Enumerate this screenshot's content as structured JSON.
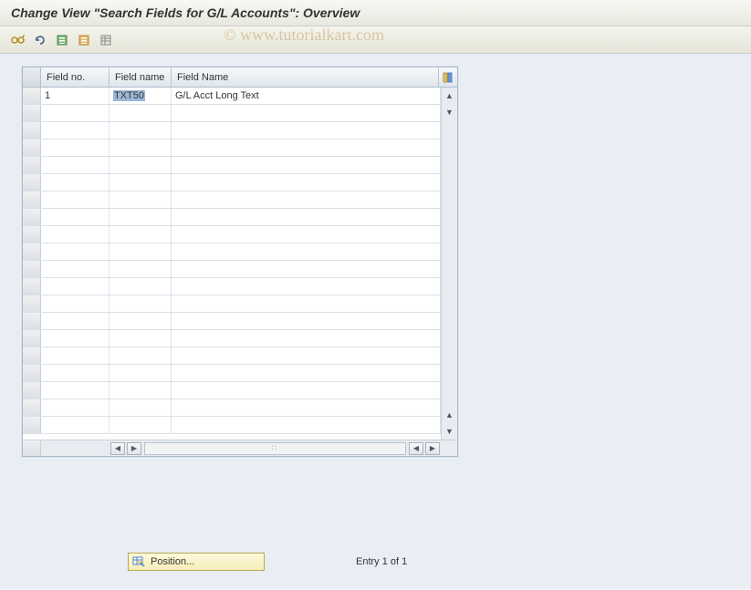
{
  "header": {
    "title": "Change View \"Search Fields for G/L Accounts\": Overview"
  },
  "toolbar": {
    "icons": {
      "glasses": "glasses-icon",
      "undo": "undo-icon",
      "save_green": "save-green-icon",
      "save_orange": "save-orange-icon",
      "list": "list-icon"
    }
  },
  "table": {
    "columns": {
      "field_no": "Field no.",
      "field_name_short": "Field name",
      "field_name_long": "Field Name"
    },
    "rows": [
      {
        "field_no": "1",
        "field_name": "TXT50",
        "field_desc": "G/L Acct Long Text"
      }
    ]
  },
  "footer": {
    "position_label": "Position...",
    "entry_text": "Entry 1 of 1"
  },
  "watermark": "© www.tutorialkart.com"
}
